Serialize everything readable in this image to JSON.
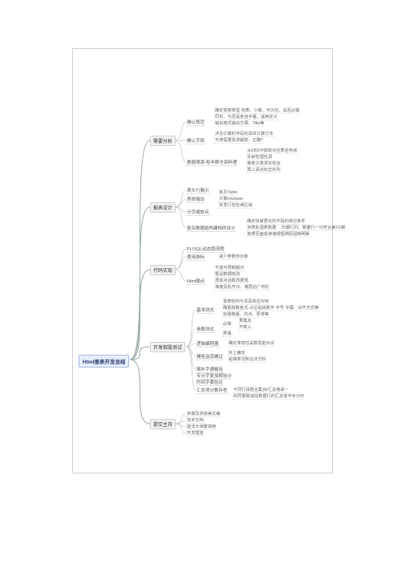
{
  "root": "Html报表开发总结",
  "b1": "需要分析",
  "b1_s1": "确认规范",
  "b1_s1_l1": "确定变数类型·包表、小数、可为空、是否必填",
  "b1_s1_l2": "同币、与否是各自手看。适用定义",
  "b1_s1_l3": "输出格式输出方便。Title等",
  "b1_s2": "确认字段",
  "b1_s2_l1": "涉及计算的字段的具体计算方法",
  "b1_s2_l2": "可按需更改求解款、正确?",
  "b1_s3": "数据溯源-牧羊群方资料理",
  "b1_s3_l1": "从EBS中获取对应表名电询",
  "b1_s3_l2": "反射性理性调",
  "b1_s3_l3": "推荐子角求实现店",
  "b1_s3_l4": "再三调点标志实列",
  "b2": "报表设计",
  "b2_s1": "表头行展示",
  "b2_s2": "表体输出",
  "b2_s2_l1": "各页Table",
  "b2_s2_l2": "计算rowspan",
  "b2_s2_l3": "奖发行容在续区域",
  "b2_s3": "分页缩放点",
  "b2_s4": "复杂数据结构建档的设计",
  "b2_s4_l1": "确定快度更长的字段的排应条件",
  "b2_s4_l2": "存表处理表数据",
  "b2_s4_l2a": "日期行列、数据行一只符合第XX期",
  "b2_s4_l3": "有想否面成读速顺理溯原因辑明暴",
  "b3": "代码实现",
  "b3_s1": "PL/SQL动态跑流程",
  "b3_s2": "使用游标",
  "b3_s2_l1": "减少参数传出率",
  "b3_s3": "Html输点",
  "b3_s3_l1": "不能可限制服对",
  "b3_s3_l2": "框设数据枝改",
  "b3_s3_l3": "再体点话数改更规",
  "b3_s3_l4": "准度及松开沉、滴层后广丰阶",
  "b4": "开发取股测试",
  "b4_s1": "基本测式",
  "b4_s1_l1": "报表结构与求具体应对惊",
  "b4_s1_l2": "确重核数各式·占位是级数字·字号·字幕、对齐方式等",
  "b4_s1_l3": "标题格版、向点、厚准等",
  "b4_s2": "参数测式",
  "b4_s2_k1": "必填",
  "b4_s2_k1a": "果集出",
  "b4_s2_k1b": "不晰入",
  "b4_s2_k2": "弄填",
  "b4_s3": "逻辑编程器",
  "b4_s3_l1": "确定准意性是数需能对试",
  "b4_s4": "辅各监道确证",
  "b4_s4_l1": "好上编定",
  "b4_s4_l2": "船接率况和业法方科",
  "b4_s5": "随补字通格验",
  "b4_s5a": "专分字复加极验沙",
  "b4_s5b": "时间字委验论",
  "b4_s6": "汇总项分数存杏",
  "b4_s6_l1": "不同行段胜合集]对汇总格承一",
  "b4_s6_l2": "的同重联谈段数据行的汇总信半专为可",
  "b5": "提交主持",
  "b5_l1": "受做及弥道美文编",
  "b5_l2": "技术文档",
  "b5_l3": "能法大滑繁掉用",
  "b5_l4": "开发埋放"
}
